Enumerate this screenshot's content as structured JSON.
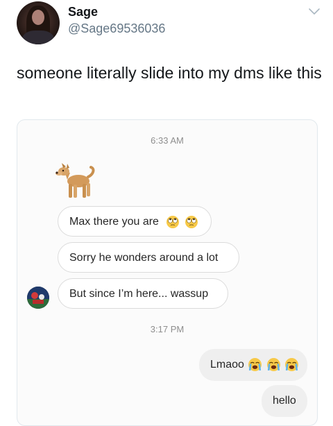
{
  "tweet": {
    "display_name": "Sage",
    "handle": "@Sage69536036",
    "text": "someone literally slide into my dms like this"
  },
  "icons": {
    "options": "chevron-down-icon",
    "dog": "dog-emoji",
    "eyeroll": "face-with-rolling-eyes-emoji",
    "crying": "loudly-crying-face-emoji"
  },
  "dm": {
    "timestamp_1": "6:33 AM",
    "timestamp_2": "3:17 PM",
    "messages_received": [
      {
        "text": "Max there you are"
      },
      {
        "text": "Sorry he wonders around a lot"
      },
      {
        "text": "But since I’m here... wassup"
      }
    ],
    "messages_sent": [
      {
        "text": "Lmaoo"
      },
      {
        "text": "hello"
      }
    ]
  },
  "colors": {
    "handle_gray": "#657786",
    "bubble_received_border": "#dbdbdb",
    "bubble_sent_bg": "#efefef",
    "timestamp_gray": "#8e8e8e"
  }
}
